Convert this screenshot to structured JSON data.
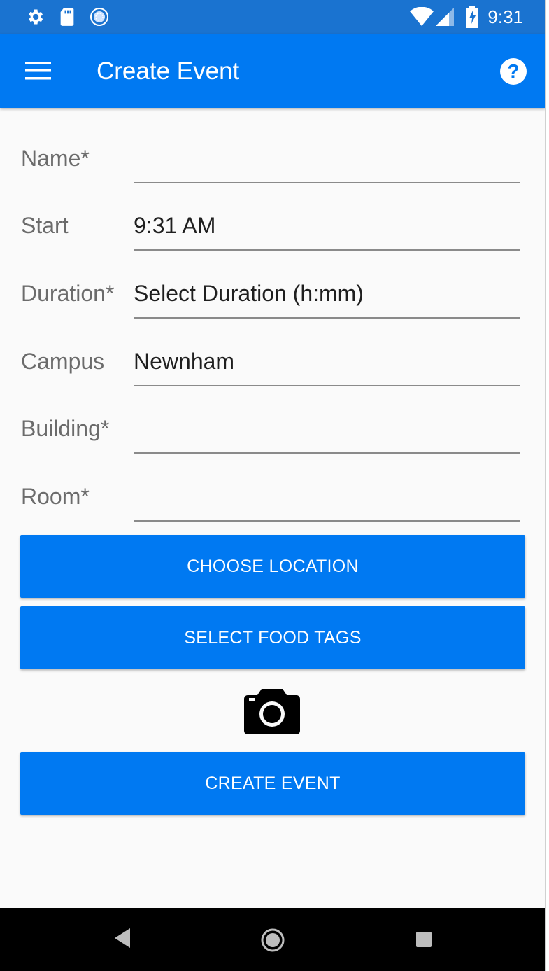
{
  "status_bar": {
    "time": "9:31",
    "icons": [
      "gear-icon",
      "sd-card-icon",
      "sync-icon",
      "wifi-icon",
      "cell-signal-icon",
      "battery-charging-icon"
    ]
  },
  "app_bar": {
    "title": "Create Event",
    "menu_icon": "hamburger-menu-icon",
    "help_icon": "help-circle-icon"
  },
  "form": {
    "name": {
      "label": "Name*",
      "value": ""
    },
    "start": {
      "label": "Start",
      "value": "9:31 AM"
    },
    "duration": {
      "label": "Duration*",
      "value": "Select Duration (h:mm)"
    },
    "campus": {
      "label": "Campus",
      "value": "Newnham"
    },
    "building": {
      "label": "Building*",
      "value": ""
    },
    "room": {
      "label": "Room*",
      "value": ""
    }
  },
  "buttons": {
    "choose_location": "CHOOSE LOCATION",
    "select_food_tags": "SELECT FOOD TAGS",
    "camera_icon": "camera-icon",
    "create_event": "CREATE EVENT"
  },
  "nav_bar": {
    "icons": [
      "back-triangle-icon",
      "home-circle-icon",
      "recents-square-icon"
    ]
  },
  "colors": {
    "status_bar": "#1a73d0",
    "primary": "#0079f2",
    "background": "#fafafa",
    "label": "#6b6b6b"
  }
}
